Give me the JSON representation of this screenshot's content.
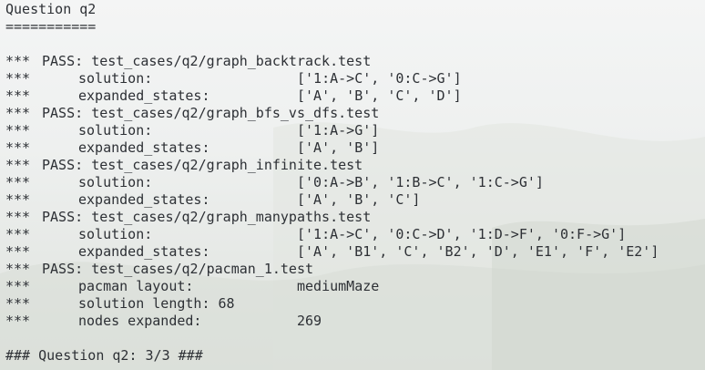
{
  "header": {
    "title": "Question q2",
    "underline": "==========="
  },
  "results": [
    {
      "prefix": "***",
      "status": "PASS:",
      "test": "test_cases/q2/graph_backtrack.test",
      "fields": [
        {
          "prefix": "***",
          "key": "solution:",
          "value": "['1:A->C', '0:C->G']"
        },
        {
          "prefix": "***",
          "key": "expanded_states:",
          "value": "['A', 'B', 'C', 'D']"
        }
      ]
    },
    {
      "prefix": "***",
      "status": "PASS:",
      "test": "test_cases/q2/graph_bfs_vs_dfs.test",
      "fields": [
        {
          "prefix": "***",
          "key": "solution:",
          "value": "['1:A->G']"
        },
        {
          "prefix": "***",
          "key": "expanded_states:",
          "value": "['A', 'B']"
        }
      ]
    },
    {
      "prefix": "***",
      "status": "PASS:",
      "test": "test_cases/q2/graph_infinite.test",
      "fields": [
        {
          "prefix": "***",
          "key": "solution:",
          "value": "['0:A->B', '1:B->C', '1:C->G']"
        },
        {
          "prefix": "***",
          "key": "expanded_states:",
          "value": "['A', 'B', 'C']"
        }
      ]
    },
    {
      "prefix": "***",
      "status": "PASS:",
      "test": "test_cases/q2/graph_manypaths.test",
      "fields": [
        {
          "prefix": "***",
          "key": "solution:",
          "value": "['1:A->C', '0:C->D', '1:D->F', '0:F->G']"
        },
        {
          "prefix": "***",
          "key": "expanded_states:",
          "value": "['A', 'B1', 'C', 'B2', 'D', 'E1', 'F', 'E2']"
        }
      ]
    },
    {
      "prefix": "***",
      "status": "PASS:",
      "test": "test_cases/q2/pacman_1.test",
      "fields": [
        {
          "prefix": "***",
          "key": "pacman layout:",
          "value": "mediumMaze"
        },
        {
          "prefix": "***",
          "key": "solution length: 68",
          "value": ""
        },
        {
          "prefix": "***",
          "key": "nodes expanded:",
          "value": "269"
        }
      ]
    }
  ],
  "summary": "### Question q2: 3/3 ###"
}
